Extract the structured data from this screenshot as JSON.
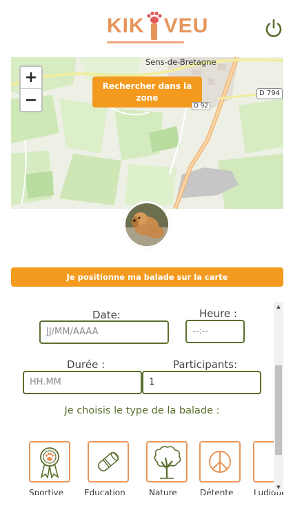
{
  "header": {
    "logo_text_left": "KIK",
    "logo_text_right": "VEU",
    "power_icon": "power-icon"
  },
  "map": {
    "zoom_in": "+",
    "zoom_out": "−",
    "search_zone_label": "Rechercher dans la zone",
    "town_label": "Sens-de-Bretagne",
    "road_badge": "D 794",
    "road_small": "D 92"
  },
  "position_button": "Je positionne ma balade sur la carte",
  "form": {
    "date_label": "Date:",
    "date_placeholder": "JJ/MM/AAAA",
    "time_label": "Heure :",
    "time_placeholder": "--:--",
    "duration_label": "Durée :",
    "duration_placeholder": "HH.MM",
    "participants_label": "Participants:",
    "participants_value": "1",
    "type_title": "Je choisis le type de la balade :",
    "types": [
      {
        "label": "Sportive",
        "icon": "award-ribbon-icon"
      },
      {
        "label": "Education",
        "icon": "diploma-icon"
      },
      {
        "label": "Nature",
        "icon": "tree-icon"
      },
      {
        "label": "Détente",
        "icon": "peace-icon"
      },
      {
        "label": "Ludique",
        "icon": "next-type-icon"
      }
    ]
  },
  "colors": {
    "orange": "#f39a1f",
    "logo": "#e8955a",
    "green": "#5a6f2d"
  }
}
